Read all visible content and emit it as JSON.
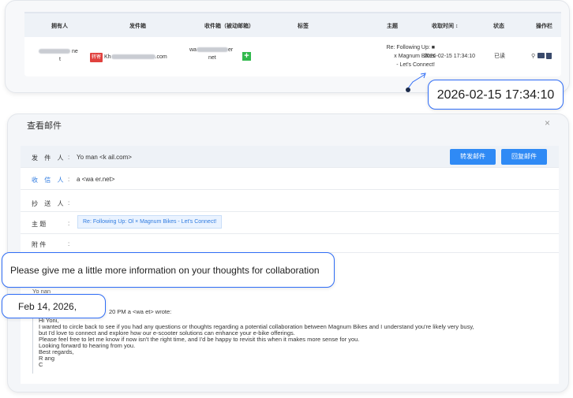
{
  "list": {
    "headers": {
      "owner": "拥有人",
      "from_mailbox": "发件箱",
      "to_mailbox": "收件箱（被动邮箱）",
      "tags": "标签",
      "subject": "主题",
      "received_time": "收取时间 ↕",
      "status": "状态",
      "actions": "操作栏"
    },
    "row": {
      "owner_tail1": "ne",
      "owner_tail2": "t",
      "from_tag": "转寄",
      "from_prefix": "Kh",
      "from_suffix": ".com",
      "to_prefix": "wa",
      "to_suffix": "er",
      "to_tail": "net",
      "subject_line1": "Re: Following Up: ■",
      "subject_line2": "x Magnum Bikes",
      "subject_line3": "- Let's Connect!",
      "received_time": "2026-02-15 17:34:10",
      "status": "已读"
    }
  },
  "callouts": {
    "time": "2026-02-15 17:34:10",
    "note": "Please give me a little more information on your thoughts for collaboration",
    "date": "Feb 14, 2026,"
  },
  "detail": {
    "title": "查看邮件",
    "close": "×",
    "from_label": "发 件 人",
    "from_value": "Yo            man <k                              ail.com>",
    "to_label": "收 信 人",
    "to_value": "            a <wa                        er.net>",
    "cc_label": "抄 送 人",
    "subject_label": "主      题",
    "subject_value": "Re: Following Up: Ol       × Magnum Bikes - Let's Connect!",
    "attach_label": "附      件",
    "colon": ":",
    "forward_button": "转发邮件",
    "reply_button": "回复邮件"
  },
  "message": {
    "signature_name": "Yo           nan",
    "quote_header": "20 PM              a <wa                           et> wrote:",
    "lines": [
      "Hi Yoni,",
      "I wanted to circle back to see if you had any questions or thoughts regarding a potential collaboration between Magnum Bikes and           I understand you're likely very busy,",
      "but I'd love to connect and explore how our e-scooter solutions can enhance your e-bike offerings.",
      "Please feel free to let me know if now isn't the right time, and I'd be happy to revisit this when it makes more sense for you.",
      "Looking forward to hearing from you.",
      "Best regards,",
      "R             ang",
      "C"
    ]
  },
  "colors": {
    "accent_blue": "#2f8af5",
    "callout_border": "#2f6df6",
    "tag_red": "#e0413e",
    "add_green": "#31b94d"
  }
}
